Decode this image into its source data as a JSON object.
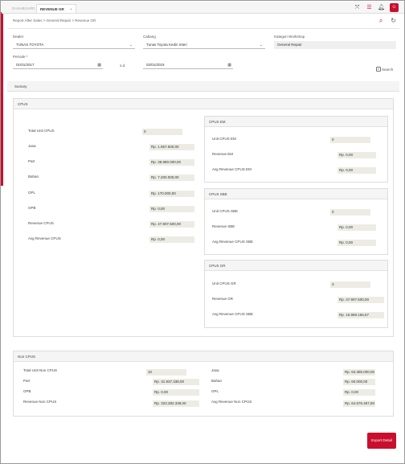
{
  "tabs": {
    "dashboard": "DASHBOARD",
    "active": "REVENUE GR",
    "close": "×"
  },
  "top_icons": [
    "expand-icon",
    "grid-icon",
    "bell-icon",
    "user-avatar"
  ],
  "breadcrumb": "Report After Sales > General Repair > Revenue GR",
  "filters": {
    "dealer": {
      "label": "Dealer",
      "value": "TUNAS TOYOTA"
    },
    "cabang": {
      "label": "Cabang",
      "value": "Tunas Toyota Kedin Interi"
    },
    "kategori": {
      "label": "Kategori Workshop",
      "value": "General Repair"
    },
    "periode": {
      "label": "Periode *",
      "from": "01/01/2017",
      "sd": "s.d.",
      "to": "02/01/2019"
    },
    "search_label": "Search"
  },
  "summary_label": "Sumary",
  "cpus": {
    "title": "CPUS",
    "rows": [
      {
        "label": "Total Unit CPUS",
        "value": "0"
      },
      {
        "label": "Jasa",
        "value": "Rp. 1.557.500,00"
      },
      {
        "label": "Part",
        "value": "Rp. 38.980.000,00"
      },
      {
        "label": "Bahan",
        "value": "Rp. 7.200.000,00"
      },
      {
        "label": "OPL",
        "value": "Rp. 170.000,00"
      },
      {
        "label": "OPB",
        "value": "Rp. 0,00"
      },
      {
        "label": "Revenue CPUS",
        "value": "Rp. 47.907.500,00"
      },
      {
        "label": "Avg Revenue CPUS",
        "value": "Rp. 0,00"
      }
    ]
  },
  "cpus_em": {
    "title": "CPUS EM",
    "rows": [
      {
        "label": "Unit CPUS EM",
        "value": "0"
      },
      {
        "label": "Revenue EM",
        "value": "Rp. 0,00"
      },
      {
        "label": "Avg Revenue CPUS EM",
        "value": "Rp. 0,00"
      }
    ]
  },
  "cpus_sbe": {
    "title": "CPUS SBE",
    "rows": [
      {
        "label": "Unit CPUS SBE",
        "value": "0"
      },
      {
        "label": "Revenue SBE",
        "value": "Rp. 0,00"
      },
      {
        "label": "Avg Revenue CPUS SBE",
        "value": "Rp. 0,00"
      }
    ]
  },
  "cpus_gr": {
    "title": "CPUS GR",
    "rows": [
      {
        "label": "Unit CPUS GR",
        "value": "3"
      },
      {
        "label": "Revenue GR",
        "value": "Rp. 47.907.500,00"
      },
      {
        "label": "Avg Revenue CPUS SBE",
        "value": "Rp. 15.969.166,67"
      }
    ]
  },
  "non_cpus": {
    "title": "Non CPUS",
    "left": [
      {
        "label": "Total Unit Non CPUS",
        "value": "10"
      },
      {
        "label": "Part",
        "value": "Rp. 31.937.338,00"
      },
      {
        "label": "OPB",
        "value": "Rp. 0,00"
      },
      {
        "label": "Revenue Non CPUS",
        "value": "Rp. 323.382.338,00"
      }
    ],
    "right": [
      {
        "label": "Jasa",
        "value": "Rp. 63.385.000,00"
      },
      {
        "label": "Bahan",
        "value": "Rp. 60.000,00"
      },
      {
        "label": "OPL",
        "value": "Rp. 0,00"
      },
      {
        "label": "Avg Revenue Non CPUS",
        "value": "Rp. 64.676.467,60"
      }
    ]
  },
  "export_label": "Export Detail",
  "colors": {
    "accent": "#c8102e",
    "value_bg": "#ecece4"
  }
}
